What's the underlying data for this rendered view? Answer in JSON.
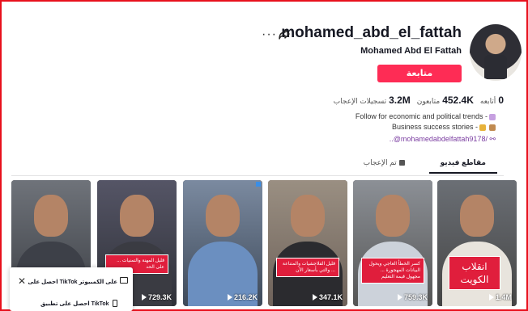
{
  "profile": {
    "username": "mohamed_abd_el_fattah",
    "display_name": "Mohamed Abd El Fattah",
    "follow_label": "متابعة",
    "more_icon": "more-icon",
    "share_icon": "share-icon"
  },
  "stats": [
    {
      "value": "0",
      "label": "أتابعه"
    },
    {
      "value": "452.4K",
      "label": "متابعون"
    },
    {
      "value": "3.2M",
      "label": "تسجيلات الإعجاب"
    }
  ],
  "bio": {
    "line1": "Follow for economic and political trends -",
    "line2": "Business success stories -",
    "link": "..@mohamedabdelfattah9178/"
  },
  "tabs": [
    {
      "label": "مقاطع فيديو",
      "active": true
    },
    {
      "label": "تم الإعجاب",
      "active": false
    }
  ],
  "videos": [
    {
      "views": "1.4M",
      "caption": "انقلاب الكويت"
    },
    {
      "views": "759.3K",
      "caption": "كسر الخطأ العاجي ويحول البيانات المهجورة ... مجهول قيمة التعليم"
    },
    {
      "views": "347.1K",
      "caption": "قليل الفلاجشيات والمتناعة ... والتي بأسعار الآن"
    },
    {
      "views": "216.2K",
      "caption": ""
    },
    {
      "views": "729.3K",
      "caption": "قليل المهنة والتمنيات ... على الحد"
    },
    {
      "views": "",
      "caption": ""
    }
  ],
  "popup": {
    "row1": "احصل على TikTok على الكمبيوتر",
    "row2": "احصل على تطبيق TikTok"
  }
}
